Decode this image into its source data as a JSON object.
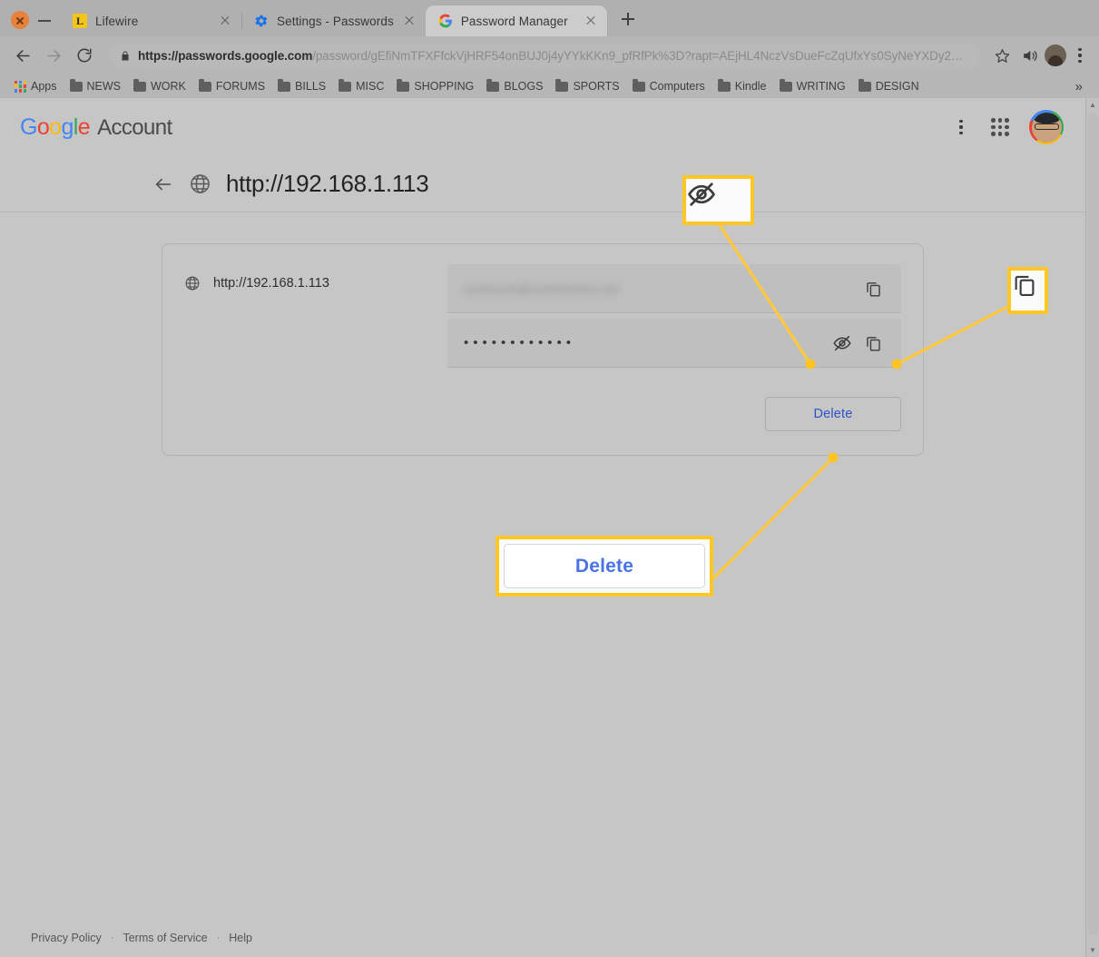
{
  "window": {
    "close_label": "Close window",
    "minimize_label": "Minimize window"
  },
  "tabs": [
    {
      "title": "Lifewire",
      "favicon": "lifewire-icon",
      "active": false
    },
    {
      "title": "Settings - Passwords",
      "favicon": "gear-icon",
      "active": false
    },
    {
      "title": "Password Manager",
      "favicon": "google-g-icon",
      "active": true
    }
  ],
  "newtab_label": "+",
  "omnibox": {
    "url_secure": "https://passwords.google.com",
    "url_path": "/password/gEfiNmTFXFfckVjHRF54onBUJ0j4yYYkKKn9_pfRfPk%3D?rapt=AEjHL4NczVsDueFcZqUfxYs0SyNeYXDy2…",
    "lock_icon": "lock-icon",
    "back_icon": "back-arrow-icon",
    "forward_icon": "forward-arrow-icon",
    "reload_icon": "reload-icon",
    "bookmark_icon": "star-icon",
    "audio_icon": "speaker-playing-icon",
    "profile_icon": "profile-avatar-icon",
    "menu_icon": "kebab-menu-icon"
  },
  "bookmarks": {
    "apps_label": "Apps",
    "items": [
      "NEWS",
      "WORK",
      "FORUMS",
      "BILLS",
      "MISC",
      "SHOPPING",
      "BLOGS",
      "SPORTS",
      "Computers",
      "Kindle",
      "WRITING",
      "DESIGN"
    ],
    "overflow_label": "»"
  },
  "page": {
    "logo": {
      "g1": "G",
      "o1": "o",
      "o2": "o",
      "g2": "g",
      "l": "l",
      "e": "e",
      "account": "Account"
    },
    "header_menu_icon": "kebab-menu-icon",
    "header_apps_icon": "google-apps-grid-icon",
    "header_avatar_icon": "account-avatar",
    "title": "http://192.168.1.113",
    "title_icon": "globe-icon",
    "back_icon": "back-arrow-icon",
    "card": {
      "site_icon": "globe-icon",
      "site_label": "http://192.168.1.113",
      "username_value": "someone@somewhere.net",
      "username_copy_icon": "copy-icon",
      "password_value": "••••••••••••",
      "password_show_icon": "eye-slash-icon",
      "password_copy_icon": "copy-icon",
      "delete_label": "Delete"
    },
    "footer": {
      "privacy": "Privacy Policy",
      "separator": "·",
      "terms": "Terms of Service",
      "help": "Help"
    }
  },
  "annotations": {
    "accent_color": "#ffc726",
    "line_color": "#ffc83d",
    "callouts": [
      {
        "name": "eye-slash-callout",
        "icon": "eye-slash-icon",
        "label": ""
      },
      {
        "name": "copy-callout",
        "icon": "copy-icon",
        "label": ""
      },
      {
        "name": "delete-callout",
        "icon": "",
        "label": "Delete"
      }
    ]
  },
  "scrollbar": {
    "up_arrow": "▲",
    "down_arrow": "▼"
  }
}
